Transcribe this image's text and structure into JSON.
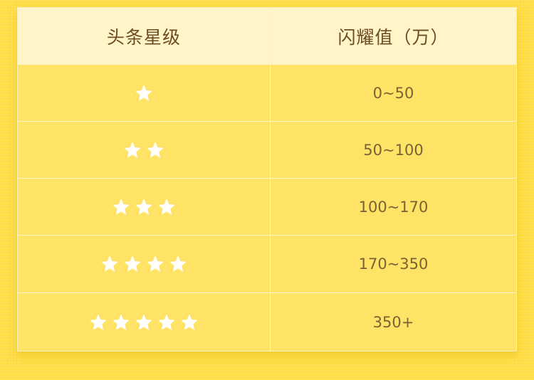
{
  "table": {
    "headers": {
      "level": "头条星级",
      "flash_value": "闪耀值（万）"
    },
    "rows": [
      {
        "stars": 1,
        "range": "0~50"
      },
      {
        "stars": 2,
        "range": "50~100"
      },
      {
        "stars": 3,
        "range": "100~170"
      },
      {
        "stars": 4,
        "range": "170~350"
      },
      {
        "stars": 5,
        "range": "350+"
      }
    ]
  },
  "colors": {
    "page_background": "#ffdd3c",
    "header_background": "#fff5c9",
    "row_background": "#ffe367",
    "star": "#ffffff"
  },
  "icons": {
    "rating": "star-icon"
  }
}
